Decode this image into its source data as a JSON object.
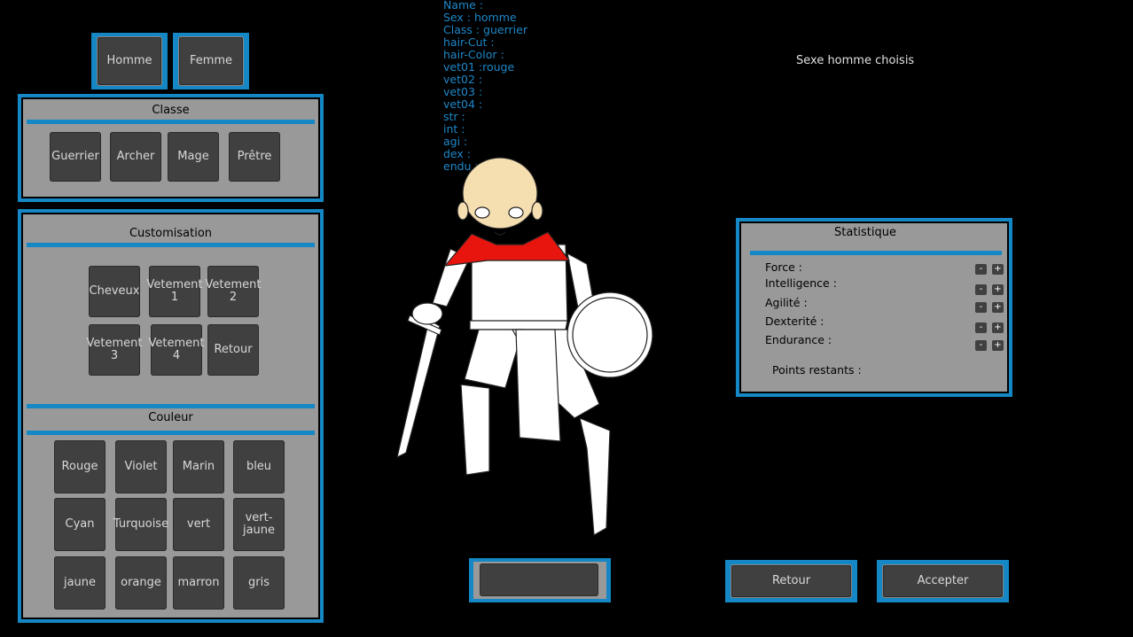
{
  "sex": {
    "homme": "Homme",
    "femme": "Femme"
  },
  "classe": {
    "title": "Classe",
    "buttons": [
      "Guerrier",
      "Archer",
      "Mage",
      "Prêtre"
    ]
  },
  "custom": {
    "title": "Customisation",
    "buttons": [
      "Cheveux",
      "Vetement 1",
      "Vetement 2",
      "Vetement 3",
      "Vetement 4",
      "Retour"
    ]
  },
  "couleur": {
    "title": "Couleur",
    "buttons": [
      "Rouge",
      "Violet",
      "Marin",
      "bleu",
      "Cyan",
      "Turquoise",
      "vert",
      "vert-jaune",
      "jaune",
      "orange",
      "marron",
      "gris"
    ]
  },
  "info": [
    "Name :",
    "Sex : homme",
    "Class : guerrier",
    "hair-Cut :",
    "hair-Color :",
    "vet01 :rouge",
    "vet02 :",
    "vet03 :",
    "vet04 :",
    "str :",
    "int :",
    "agi :",
    "dex :",
    "endu :"
  ],
  "message": "Sexe homme choisis",
  "stats": {
    "title": "Statistique",
    "labels": [
      "Force :",
      "Intelligence :",
      "Agilité :",
      "Dexterité :",
      "Endurance :"
    ],
    "remaining": "Points restants :",
    "minus": "-",
    "plus": "+"
  },
  "bottom": {
    "name_value": "",
    "retour": "Retour",
    "accepter": "Accepter"
  },
  "colors": {
    "accent": "#1487c4",
    "panel": "#999999",
    "button": "#404040"
  }
}
